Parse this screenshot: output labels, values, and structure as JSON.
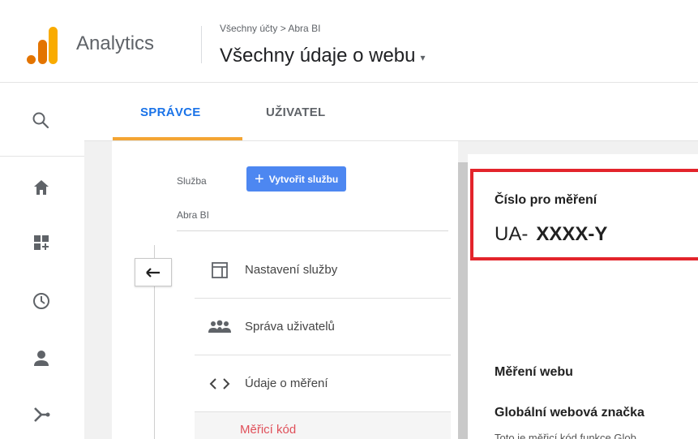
{
  "header": {
    "app_name": "Analytics",
    "breadcrumb": "Všechny účty > Abra BI",
    "view_title": "Všechny údaje o webu",
    "caret": "▾"
  },
  "tabs": [
    {
      "label": "SPRÁVCE",
      "active": true
    },
    {
      "label": "UŽIVATEL",
      "active": false
    }
  ],
  "colors": {
    "accent": "#1a73e8",
    "tab_underline": "#f4a533",
    "create_button": "#4d87f1",
    "highlight": "#e3242b",
    "active_subitem": "#e0505a"
  },
  "rail": {
    "icons": [
      "search-icon",
      "home-icon",
      "customization-icon",
      "realtime-icon",
      "audience-icon",
      "acquisition-icon"
    ]
  },
  "property": {
    "label": "Služba",
    "create_button": "Vytvořit službu",
    "name": "Abra BI",
    "menu": [
      {
        "icon": "property-settings-icon",
        "label": "Nastavení služby"
      },
      {
        "icon": "user-management-icon",
        "label": "Správa uživatelů"
      },
      {
        "icon": "code-icon",
        "label": "Údaje o měření"
      }
    ],
    "active_subitem": "Měřicí kód"
  },
  "tracking": {
    "label": "Číslo pro měření",
    "prefix": "UA-",
    "id": "XXXX-Y"
  },
  "web_measurement": {
    "title": "Měření webu",
    "subtitle": "Globální webová značka",
    "text": "Toto je měřicí kód funkce Glob"
  }
}
